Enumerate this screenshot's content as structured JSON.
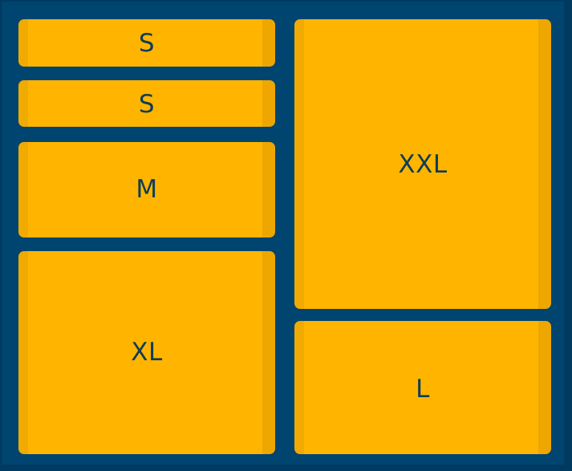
{
  "blocks": {
    "s1": {
      "label": "S"
    },
    "s2": {
      "label": "S"
    },
    "m": {
      "label": "M"
    },
    "xl": {
      "label": "XL"
    },
    "xxl": {
      "label": "XXL"
    },
    "l": {
      "label": "L"
    }
  },
  "colors": {
    "frame": "#004470",
    "frame_edge": "#003a61",
    "block_fill": "#ffb500",
    "block_edge": "#eda700",
    "label_text": "#0e3c57"
  }
}
